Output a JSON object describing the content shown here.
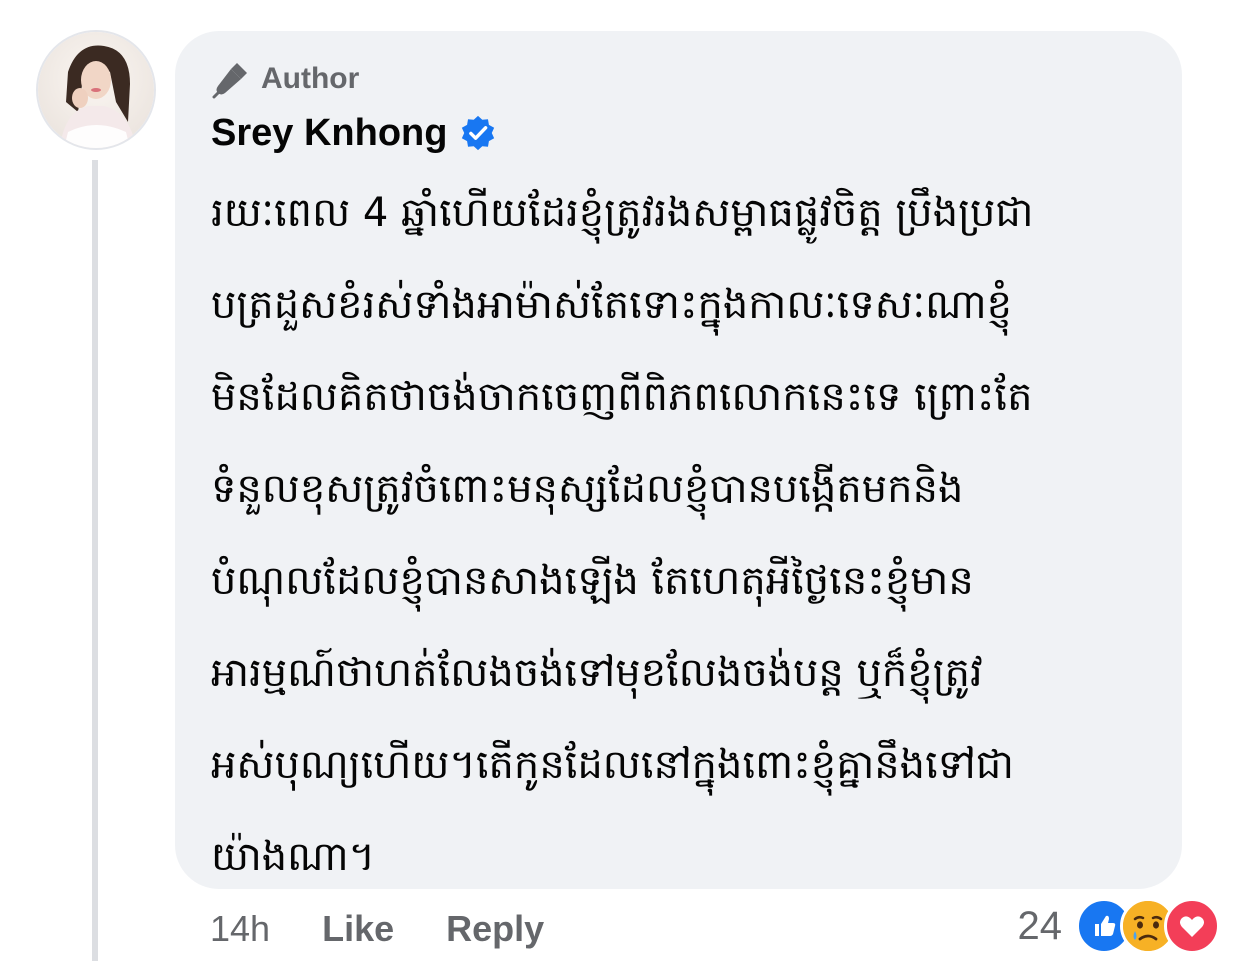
{
  "comment": {
    "badge_label": "Author",
    "author_name": "Srey Knhong",
    "verified": true,
    "text_lines": [
      "រយៈពេល 4 ឆ្នាំហើយដែរខ្ញុំត្រូវរងសម្ពាធផ្លូវចិត្ត ប្រឹងប្រជា",
      "បត្រដួសខំរស់ទាំងអាម៉ាស់តែទោះក្នុងកាលៈទេសៈណាខ្ញុំ",
      "មិនដែលគិតថាចង់ចាកចេញពីពិភពលោកនេះទេ ព្រោះតែ",
      "ទំនួលខុសត្រូវចំពោះមនុស្សដែលខ្ញុំបានបង្កើតមកនិង",
      "បំណុលដែលខ្ញុំបានសាងឡើង តែហេតុអីថ្ងៃនេះខ្ញុំមាន",
      "អារម្មណ៍ថាហត់លែងចង់ទៅមុខលែងចង់បន្ត ឬក៏ខ្ញុំត្រូវ",
      "អស់បុណ្យហើយ។តើកូនដែលនៅក្នុងពោះខ្ញុំគ្នានឹងទៅជា",
      "យ៉ាងណា។"
    ]
  },
  "footer": {
    "timestamp": "14h",
    "like_label": "Like",
    "reply_label": "Reply"
  },
  "reactions": {
    "count": "24",
    "types": [
      "like-icon",
      "sad-icon",
      "love-icon"
    ],
    "colors": {
      "like": "#1877f2",
      "sad": "#f7b125",
      "love": "#f33e58"
    }
  },
  "colors": {
    "bubble_bg": "#f0f2f5",
    "secondary_text": "#65676b",
    "primary_text": "#050505",
    "verified_blue": "#1877f2"
  }
}
